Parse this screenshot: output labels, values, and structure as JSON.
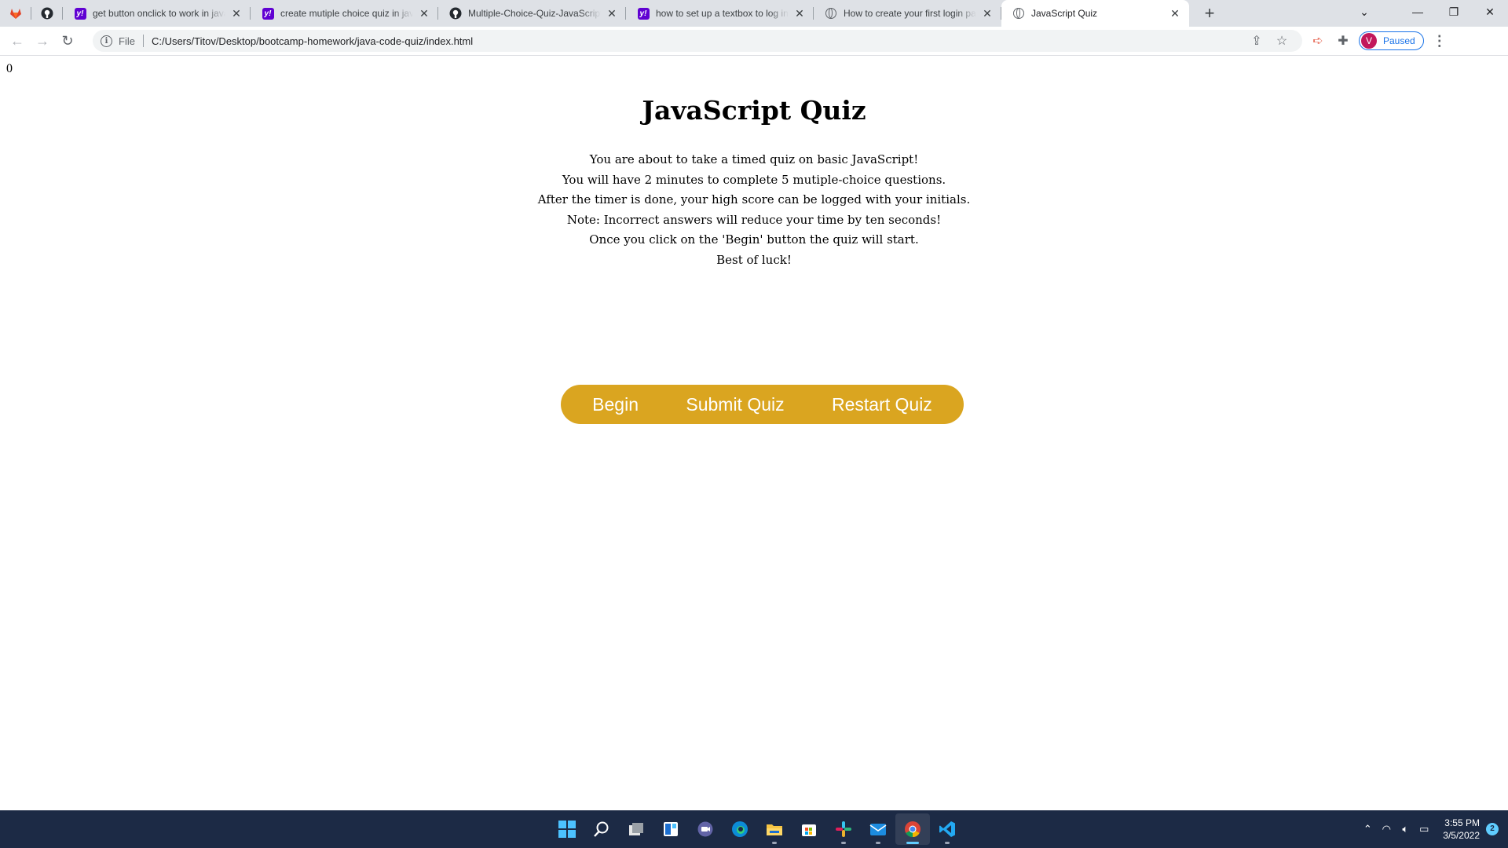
{
  "browser": {
    "pinned_tabs": [
      {
        "icon": "gitlab-icon"
      },
      {
        "icon": "github-icon"
      }
    ],
    "tabs": [
      {
        "title": "get button onclick to work in javascript",
        "icon": "yahoo-icon",
        "active": false
      },
      {
        "title": "create mutiple choice quiz in javascript",
        "icon": "yahoo-icon",
        "active": false
      },
      {
        "title": "Multiple-Choice-Quiz-JavaScript",
        "icon": "github-icon",
        "active": false
      },
      {
        "title": "how to set up a textbox to log in",
        "icon": "yahoo-icon",
        "active": false
      },
      {
        "title": "How to create your first login page",
        "icon": "globe-icon",
        "active": false
      },
      {
        "title": "JavaScript Quiz",
        "icon": "globe-icon",
        "active": true
      }
    ],
    "address": {
      "scheme_label": "File",
      "url": "C:/Users/Titov/Desktop/bootcamp-homework/java-code-quiz/index.html"
    },
    "profile": {
      "initial": "V",
      "status": "Paused"
    },
    "colors": {
      "accent": "#1a73e8",
      "avatar": "#c2185b"
    }
  },
  "page": {
    "timer": "0",
    "title": "JavaScript Quiz",
    "intro_lines": [
      "You are about to take a timed quiz on basic JavaScript!",
      "You will have 2 minutes to complete 5 mutiple-choice questions.",
      "After the timer is done, your high score can be logged with your initials.",
      "Note: Incorrect answers will reduce your time by ten seconds!",
      "Once you click on the 'Begin' button the quiz will start.",
      "Best of luck!"
    ],
    "buttons": {
      "begin": "Begin",
      "submit": "Submit Quiz",
      "restart": "Restart Quiz"
    },
    "colors": {
      "button_bar": "#daa520"
    }
  },
  "taskbar": {
    "apps": [
      {
        "icon": "windows-start-icon",
        "active": false,
        "running": false
      },
      {
        "icon": "search-icon",
        "active": false,
        "running": false
      },
      {
        "icon": "task-view-icon",
        "active": false,
        "running": false
      },
      {
        "icon": "widgets-icon",
        "active": false,
        "running": false
      },
      {
        "icon": "teams-chat-icon",
        "active": false,
        "running": false
      },
      {
        "icon": "edge-icon",
        "active": false,
        "running": false
      },
      {
        "icon": "file-explorer-icon",
        "active": false,
        "running": true
      },
      {
        "icon": "microsoft-store-icon",
        "active": false,
        "running": false
      },
      {
        "icon": "slack-icon",
        "active": false,
        "running": true
      },
      {
        "icon": "mail-icon",
        "active": false,
        "running": true
      },
      {
        "icon": "chrome-icon",
        "active": true,
        "running": true
      },
      {
        "icon": "vscode-icon",
        "active": false,
        "running": true
      }
    ],
    "clock": {
      "time": "3:55 PM",
      "date": "3/5/2022"
    },
    "notification_count": "2"
  }
}
